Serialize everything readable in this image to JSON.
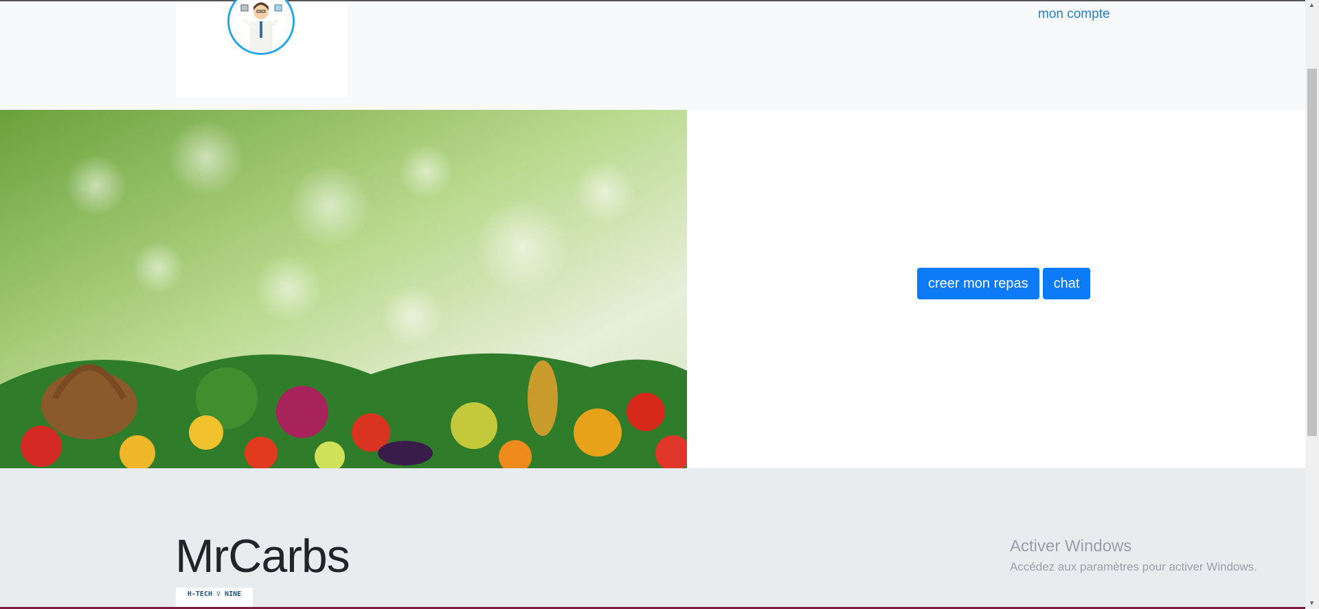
{
  "header": {
    "account_link": "mon compte"
  },
  "hero": {
    "buttons": {
      "create_meal": "creer mon repas",
      "chat": "chat"
    }
  },
  "footer": {
    "brand": "MrCarbs",
    "brand_logo_text": "H-TECH ♀ NINE"
  },
  "system_watermark": {
    "title": "Activer Windows",
    "subtitle": "Accédez aux paramètres pour activer Windows."
  },
  "colors": {
    "primary_button": "#0d7bf7",
    "link": "#2680c8",
    "logo_ring": "#2aa6e8"
  },
  "icons": [
    "doctor-avatar-icon",
    "scroll-up-arrow-icon",
    "scroll-down-arrow-icon"
  ]
}
